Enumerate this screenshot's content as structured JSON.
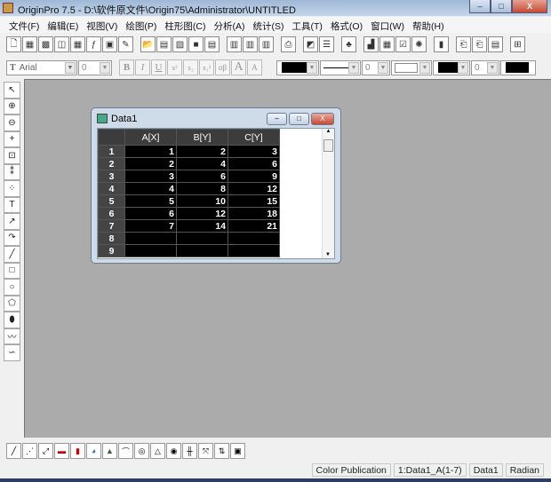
{
  "window": {
    "title": "OriginPro 7.5 - D:\\软件原文件\\Origin75\\Administrator\\UNTITLED",
    "min": "–",
    "max": "□",
    "close": "X"
  },
  "menu": [
    "文件(F)",
    "编辑(E)",
    "视图(V)",
    "绘图(P)",
    "柱形图(C)",
    "分析(A)",
    "统计(S)",
    "工具(T)",
    "格式(O)",
    "窗口(W)",
    "帮助(H)"
  ],
  "toolbar1": [
    [
      "new-icon",
      "🗋"
    ],
    [
      "new-worksheet-icon",
      "▦"
    ],
    [
      "new-excel-icon",
      "▩"
    ],
    [
      "new-graph-icon",
      "◫"
    ],
    [
      "new-matrix-icon",
      "▦"
    ],
    [
      "new-function-icon",
      "ƒ"
    ],
    [
      "new-layout-icon",
      "▣"
    ],
    [
      "new-notes-icon",
      "✎"
    ],
    null,
    [
      "open-icon",
      "📂"
    ],
    [
      "open-template-icon",
      "▤"
    ],
    [
      "open-excel-icon",
      "▧"
    ],
    [
      "save-icon",
      "■"
    ],
    [
      "save-template-icon",
      "▤"
    ],
    null,
    [
      "import-ascii-icon",
      "▥"
    ],
    [
      "import-multiple-icon",
      "▥"
    ],
    [
      "import-excel-icon",
      "▥"
    ],
    null,
    [
      "print-icon",
      "⎙"
    ],
    null,
    [
      "duplicate-icon",
      "◩"
    ],
    [
      "refresh-icon",
      "☰"
    ],
    null,
    [
      "project-explorer-icon",
      "♣"
    ],
    null,
    [
      "results-log-icon",
      "▟"
    ],
    [
      "script-window-icon",
      "▦"
    ],
    [
      "code-builder-icon",
      "☑"
    ],
    [
      "options-icon",
      "✺"
    ],
    null,
    [
      "command-window-icon",
      "▮"
    ],
    null,
    [
      "graph-tool-1-icon",
      "⎗"
    ],
    [
      "graph-tool-2-icon",
      "⎗"
    ],
    [
      "graph-tool-3-icon",
      "▤"
    ],
    null,
    [
      "graph-tool-4-icon",
      "⊞"
    ]
  ],
  "format": {
    "font": "Arial",
    "size": "0",
    "bold": "B",
    "italic": "I",
    "underline": "U",
    "sup": "x²",
    "sub": "x₂",
    "supsub": "x₁²",
    "greek": "αβ",
    "bigger": "A",
    "smaller": "A",
    "line_width": "0",
    "line2": "0",
    "line3": "0"
  },
  "tools_left": [
    [
      "pointer-icon",
      "↖"
    ],
    [
      "zoom-in-icon",
      "⊕"
    ],
    [
      "zoom-out-icon",
      "⊖"
    ],
    [
      "screen-reader-icon",
      "+"
    ],
    [
      "data-selector-icon",
      "⊡"
    ],
    [
      "data-reader-icon",
      "⁑"
    ],
    [
      "draw-data-icon",
      "⁘"
    ],
    [
      "text-tool-icon",
      "T"
    ],
    [
      "arrow-tool-icon",
      "↗"
    ],
    [
      "curved-arrow-icon",
      "↷"
    ],
    [
      "line-tool-icon",
      "╱"
    ],
    [
      "rectangle-tool-icon",
      "□"
    ],
    [
      "circle-tool-icon",
      "○"
    ],
    [
      "polygon-tool-icon",
      "⬠"
    ],
    [
      "region-tool-icon",
      "⬮"
    ],
    [
      "polyline-tool-icon",
      "〰"
    ],
    [
      "freehand-tool-icon",
      "∽"
    ]
  ],
  "tools_bottom": [
    [
      "line-plot-icon",
      "╱"
    ],
    [
      "scatter-plot-icon",
      "⋰"
    ],
    [
      "line-symbol-plot-icon",
      "⤢"
    ],
    [
      "bar-chart-icon",
      "▬"
    ],
    [
      "column-chart-icon",
      "▮"
    ],
    [
      "pie-chart-icon",
      "◕"
    ],
    [
      "area-chart-icon",
      "▲"
    ],
    [
      "fill-area-icon",
      "⌒"
    ],
    [
      "polar-plot-icon",
      "◎"
    ],
    [
      "ternary-plot-icon",
      "△"
    ],
    [
      "contour-icon",
      "◉"
    ],
    [
      "hi-lo-close-icon",
      "╫"
    ],
    [
      "vector-icon",
      "⤧"
    ],
    [
      "double-y-icon",
      "⇅"
    ],
    [
      "template-library-icon",
      "▣"
    ]
  ],
  "worksheet": {
    "title": "Data1",
    "columns": [
      "A[X]",
      "B[Y]",
      "C[Y]"
    ],
    "rows": [
      [
        "1",
        "1",
        "2",
        "3"
      ],
      [
        "2",
        "2",
        "4",
        "6"
      ],
      [
        "3",
        "3",
        "6",
        "9"
      ],
      [
        "4",
        "4",
        "8",
        "12"
      ],
      [
        "5",
        "5",
        "10",
        "15"
      ],
      [
        "6",
        "6",
        "12",
        "18"
      ],
      [
        "7",
        "7",
        "14",
        "21"
      ],
      [
        "8",
        "",
        "",
        ""
      ],
      [
        "9",
        "",
        "",
        ""
      ]
    ]
  },
  "status": [
    "Color Publication",
    "1:Data1_A(1-7)",
    "Data1",
    "Radian"
  ],
  "colors": {
    "sheet_bg": "#000000",
    "workspace": "#ababab"
  }
}
